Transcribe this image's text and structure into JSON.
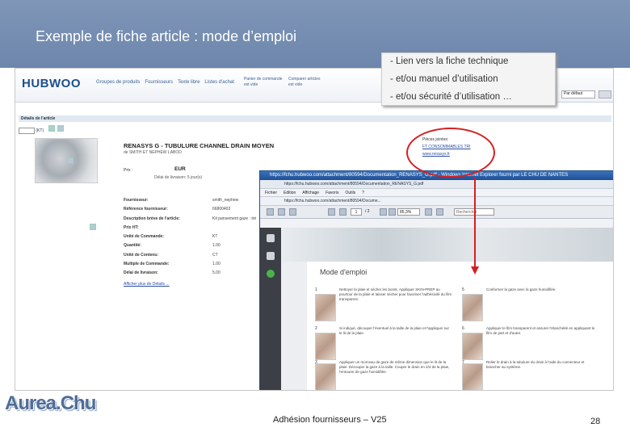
{
  "slide": {
    "title": "Exemple de fiche article : mode d’emploi",
    "footer": "Adhésion fournisseurs – V25",
    "page_number": "28"
  },
  "callout": {
    "lines": [
      "- Lien vers la fiche technique",
      "- et/ou manuel d’utilisation",
      "- et/ou sécurité d’utilisation …"
    ]
  },
  "logo": {
    "name": "Aurea.Chu"
  },
  "hubwoo": {
    "logo": "HUBWOO",
    "nav": [
      "Groupes de produits",
      "Fournisseurs",
      "Texte libre",
      "Listes d'achat"
    ],
    "cart": [
      "Panier de commande",
      "est vide"
    ],
    "cart2": [
      "Comparer articles",
      "est vide"
    ],
    "select_value": "Par défaut",
    "details_title": "Détails de l'article",
    "qty_unit": "(KT)",
    "product_name": "RENASYS G - TUBULURE CHANNEL DRAIN MOYEN",
    "maker": "de SMITH ET NEPHEW LABOD",
    "price_label": "Prix :",
    "price_value": "EUR",
    "delay": "Délai de livraison: 5 jour(s)",
    "specs": [
      {
        "k": "Fournisseur:",
        "v": "smith_nephew"
      },
      {
        "k": "Référence fournisseur:",
        "v": "66800403"
      },
      {
        "k": "Description brève de l'article:",
        "v": "Kit pansement gaze : tré"
      },
      {
        "k": "Prix HT:",
        "v": ""
      },
      {
        "k": "Unité de Commande:",
        "v": "KT"
      },
      {
        "k": "Quantité:",
        "v": "1.00"
      },
      {
        "k": "Unité de Contenu:",
        "v": "CT"
      },
      {
        "k": "Multiple de Commande:",
        "v": "1.00"
      },
      {
        "k": "Délai de livraison:",
        "v": "5.00"
      }
    ],
    "see_more": "Afficher plus de Détails ...",
    "attachments_label": "Pièces jointes:",
    "attachment_links": [
      "FT CONSOMMABLES TRI",
      "www.renasys.fr"
    ]
  },
  "pdf": {
    "title": "https://fchu.hubwoo.com/attachment/80594/Documentation_RENASYS_G.pdf - Windows Internet Explorer fourni par LE CHU DE NANTES",
    "address": "https://fchu.hubwoo.com/attachment/80594/Documentation_RENASYS_G.pdf",
    "menu": [
      "Fichier",
      "Edition",
      "Affichage",
      "Favoris",
      "Outils",
      "?"
    ],
    "fav": "https://fchu.hubwoo.com/attachment/80594/Docume...",
    "page_input": "1",
    "page_total": "/ 2",
    "zoom": "85,3%",
    "search": "Rechercher",
    "page_title": "Mode d'emploi",
    "steps": [
      {
        "n": "1",
        "text": "Nettoyer la plaie et sécher les bords. Appliquer SKIN-PREP au pourtour de la plaie et laisser sécher pour favoriser l'adhésivité du film transparent."
      },
      {
        "n": "2",
        "text": "Si indiqué, découper l'éventuel à la taille de la plaie et l'appliquer sur le lit de la plaie."
      },
      {
        "n": "3",
        "text": "Appliquer un morceau de gaze de même dimension que le lit de la plaie. Découper la gaze à la taille. Couper le drain en 2/3 de la plaie, l'entourer de gaze humidifiée."
      },
      {
        "n": "5",
        "text": "Conformer la gaze avec la gaze humidifiée."
      },
      {
        "n": "6",
        "text": "Appliquer le film transparent et assurer l'étanchéité en appliquant le film de part et d'autre."
      },
      {
        "n": "7",
        "text": "Relier le drain à la tubulure du drain à l'aide du connecteur et brancher au système."
      }
    ]
  }
}
